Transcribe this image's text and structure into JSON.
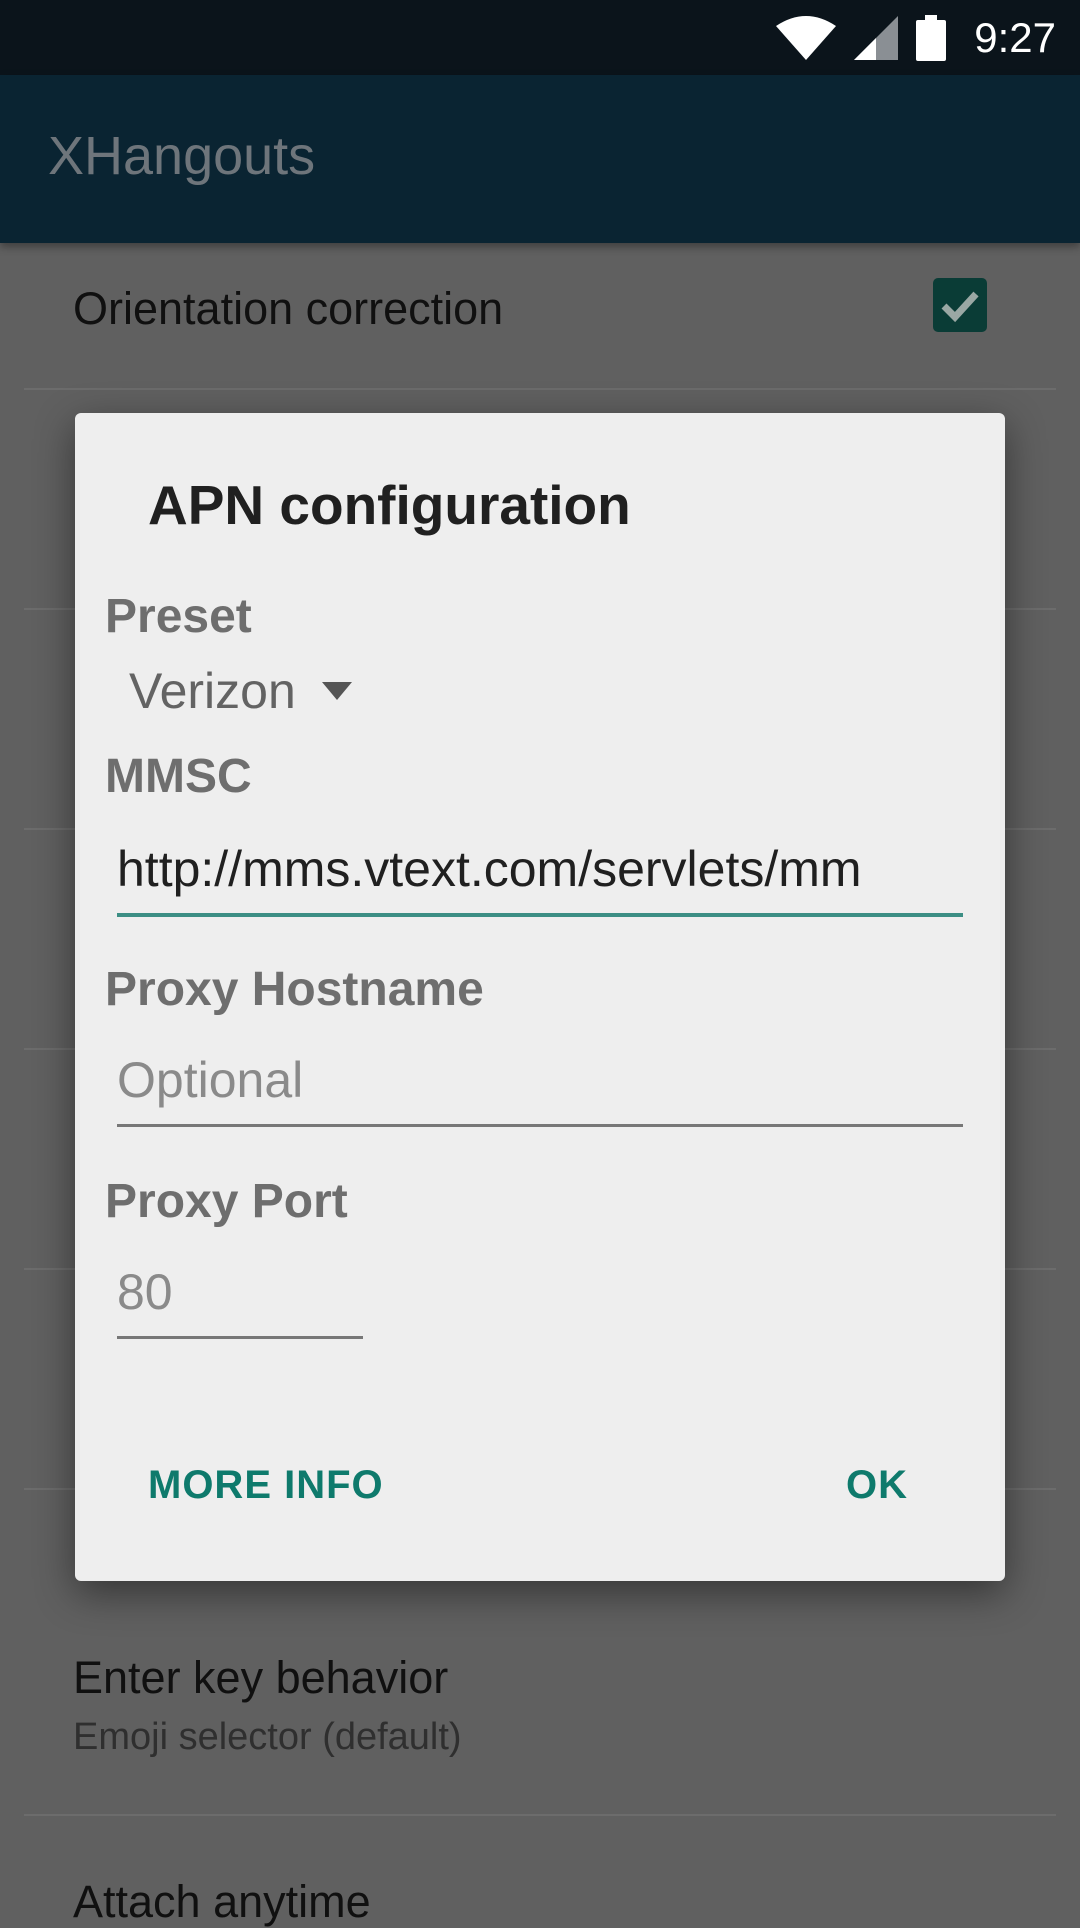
{
  "status_bar": {
    "time": "9:27",
    "icons": [
      "wifi-icon",
      "cell-signal-icon",
      "battery-icon"
    ]
  },
  "app_bar": {
    "title": "XHangouts"
  },
  "background_list": {
    "orientation_title": "Orientation correction",
    "orientation_checked": true,
    "enter_key_title": "Enter key behavior",
    "enter_key_subtitle": "Emoji selector (default)",
    "attach_title": "Attach anytime"
  },
  "dialog": {
    "title": "APN configuration",
    "preset_label": "Preset",
    "preset_value": "Verizon",
    "mmsc_label": "MMSC",
    "mmsc_value": "http://mms.vtext.com/servlets/mm",
    "proxy_host_label": "Proxy Hostname",
    "proxy_host_placeholder": "Optional",
    "proxy_port_label": "Proxy Port",
    "proxy_port_placeholder": "80",
    "more_info_label": "MORE INFO",
    "ok_label": "OK"
  },
  "colors": {
    "accent": "#0e7a6c",
    "app_bar": "#0a2432",
    "status_bar": "#0b141b",
    "dialog_bg": "#eeeeee"
  }
}
